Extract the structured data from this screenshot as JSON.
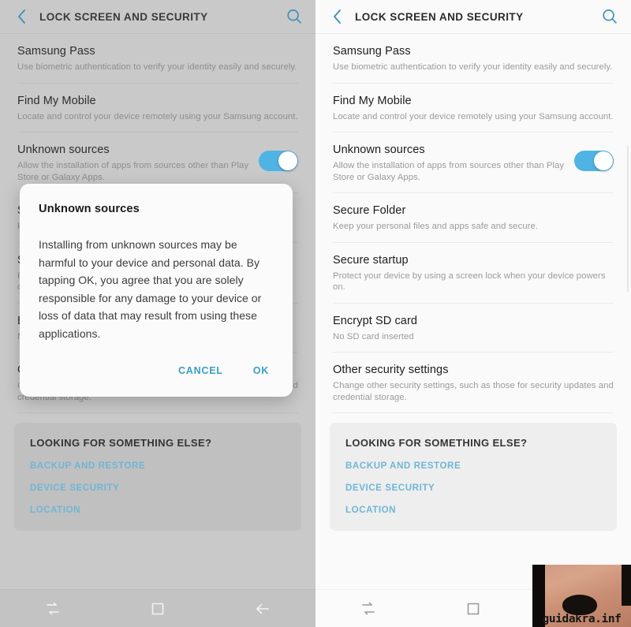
{
  "colors": {
    "accent_teal": "#3a9fc4",
    "link_blue": "#6fb6d6",
    "toggle_on": "#4fb4e4",
    "panel_bg_light": "#fafafa",
    "panel_bg_dim": "#c9c9c9",
    "card_bg_light": "#eeeeee",
    "card_bg_dim": "#c0c0c0",
    "title_text": "#1c1c1c",
    "sub_text": "#9b9b9b"
  },
  "header": {
    "back_icon": "chevron-left-icon",
    "title": "LOCK SCREEN AND SECURITY",
    "search_icon": "search-icon"
  },
  "settings_rows": [
    {
      "title": "Samsung Pass",
      "subtitle": "Use biometric authentication to verify your identity easily and securely.",
      "has_toggle": false
    },
    {
      "title": "Find My Mobile",
      "subtitle": "Locate and control your device remotely using your Samsung account.",
      "has_toggle": false
    },
    {
      "title": "Unknown sources",
      "subtitle": "Allow the installation of apps from sources other than Play Store or Galaxy Apps.",
      "has_toggle": true,
      "toggle_state": "on"
    },
    {
      "title": "Secure Folder",
      "subtitle": "Keep your personal files and apps safe and secure.",
      "has_toggle": false
    },
    {
      "title": "Secure startup",
      "subtitle": "Protect your device by using a screen lock when your device powers on.",
      "has_toggle": false
    },
    {
      "title": "Encrypt SD card",
      "subtitle": "No SD card inserted",
      "has_toggle": false
    },
    {
      "title": "Other security settings",
      "subtitle": "Change other security settings, such as those for security updates and credential storage.",
      "has_toggle": false
    }
  ],
  "looking_for_card": {
    "title": "LOOKING FOR SOMETHING ELSE?",
    "links": [
      "BACKUP AND RESTORE",
      "DEVICE SECURITY",
      "LOCATION"
    ]
  },
  "dialog": {
    "title": "Unknown sources",
    "body": "Installing from unknown sources may be harmful to your device and personal data. By tapping OK, you agree that you are solely responsible for any damage to your device or loss of data that may result from using these applications.",
    "cancel_label": "CANCEL",
    "ok_label": "OK"
  },
  "navbar": {
    "recents_icon": "recents-icon",
    "home_icon": "home-square-icon",
    "back_icon": "back-arrow-icon"
  },
  "overlay_watermark": {
    "text": "guidakra.inf"
  }
}
